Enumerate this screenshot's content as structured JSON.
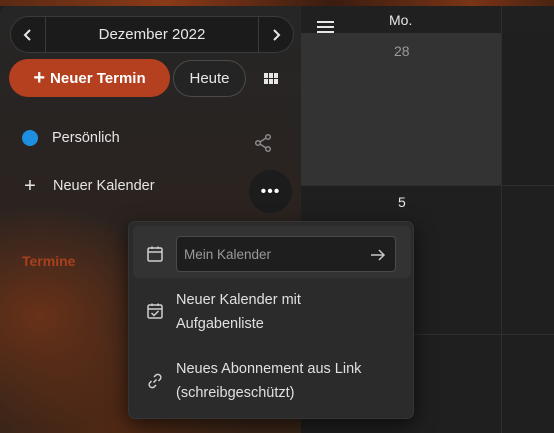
{
  "toolbar": {
    "month_label": "Dezember 2022",
    "new_event_label": "Neuer Termin",
    "today_label": "Heute",
    "prev_icon": "‹",
    "next_icon": "›"
  },
  "sidebar": {
    "calendars": [
      {
        "label": "Persönlich",
        "color": "#1e8fe0"
      }
    ],
    "new_calendar_label": "Neuer Kalender",
    "section_label": "Termine"
  },
  "calendar": {
    "day_header": "Mo.",
    "dates": [
      "28",
      "5"
    ]
  },
  "popup": {
    "input_placeholder": "Mein Kalender",
    "item1_line1": "Neuer Kalender mit",
    "item1_line2": "Aufgabenliste",
    "item2_line1": "Neues Abonnement aus Link",
    "item2_line2": "(schreibgeschützt)"
  },
  "colors": {
    "accent": "#b5401f",
    "calendar_dot": "#1e8fe0",
    "section_label": "#a8401e"
  }
}
